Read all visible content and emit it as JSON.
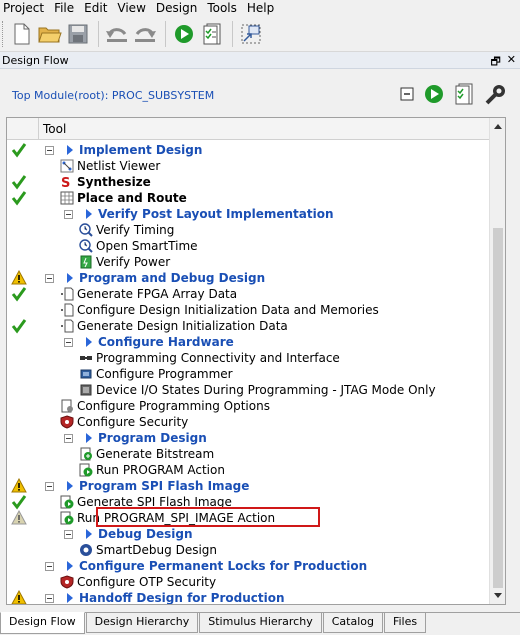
{
  "menu": [
    "Project",
    "File",
    "Edit",
    "View",
    "Design",
    "Tools",
    "Help"
  ],
  "toolbar_icons": [
    "new-file-icon",
    "open-folder-icon",
    "save-icon",
    "undo-icon",
    "redo-icon",
    "run-icon",
    "checklist-icon",
    "expand-window-icon"
  ],
  "panel": {
    "title": "Design Flow",
    "pin": "🗗",
    "close": "✕"
  },
  "top_module": "Top Module(root): PROC_SUBSYSTEM",
  "tree_header": "Tool",
  "rows": [
    {
      "label": "Implement Design",
      "style": "cat",
      "status": "check"
    },
    {
      "label": "Netlist Viewer",
      "style": "",
      "status": ""
    },
    {
      "label": "Synthesize",
      "style": "bold",
      "status": "check"
    },
    {
      "label": "Place and Route",
      "style": "bold",
      "status": "check"
    },
    {
      "label": "Verify Post Layout Implementation",
      "style": "cat",
      "status": ""
    },
    {
      "label": "Verify Timing",
      "style": "",
      "status": ""
    },
    {
      "label": "Open SmartTime",
      "style": "",
      "status": ""
    },
    {
      "label": "Verify Power",
      "style": "",
      "status": ""
    },
    {
      "label": "Program and Debug Design",
      "style": "cat",
      "status": "warn"
    },
    {
      "label": "Generate FPGA Array Data",
      "style": "",
      "status": "check"
    },
    {
      "label": "Configure Design Initialization Data and Memories",
      "style": "",
      "status": ""
    },
    {
      "label": "Generate Design Initialization Data",
      "style": "",
      "status": "check"
    },
    {
      "label": "Configure Hardware",
      "style": "cat",
      "status": ""
    },
    {
      "label": "Programming Connectivity and Interface",
      "style": "",
      "status": ""
    },
    {
      "label": "Configure Programmer",
      "style": "",
      "status": ""
    },
    {
      "label": "Device I/O States During Programming - JTAG Mode Only",
      "style": "",
      "status": ""
    },
    {
      "label": "Configure Programming Options",
      "style": "",
      "status": ""
    },
    {
      "label": "Configure Security",
      "style": "",
      "status": ""
    },
    {
      "label": "Program Design",
      "style": "cat",
      "status": ""
    },
    {
      "label": "Generate Bitstream",
      "style": "",
      "status": ""
    },
    {
      "label": "Run PROGRAM Action",
      "style": "",
      "status": ""
    },
    {
      "label": "Program SPI Flash Image",
      "style": "cat",
      "status": "warn"
    },
    {
      "label": "Generate SPI Flash Image",
      "style": "",
      "status": "check"
    },
    {
      "label": "Run PROGRAM_SPI_IMAGE Action",
      "style": "",
      "status": "warn-faded"
    },
    {
      "label": "Debug Design",
      "style": "cat",
      "status": ""
    },
    {
      "label": "SmartDebug Design",
      "style": "",
      "status": ""
    },
    {
      "label": "Configure Permanent Locks for Production",
      "style": "cat",
      "status": ""
    },
    {
      "label": "Configure OTP Security",
      "style": "",
      "status": ""
    },
    {
      "label": "Handoff Design for Production",
      "style": "cat",
      "status": "warn"
    }
  ],
  "tabs": [
    "Design Flow",
    "Design Hierarchy",
    "Stimulus Hierarchy",
    "Catalog",
    "Files"
  ],
  "active_tab": "Design Flow",
  "colors": {
    "accent": "#1a4fb5",
    "check": "#2b9a1e",
    "warn": "#e8b100",
    "highlight": "#d01818"
  }
}
